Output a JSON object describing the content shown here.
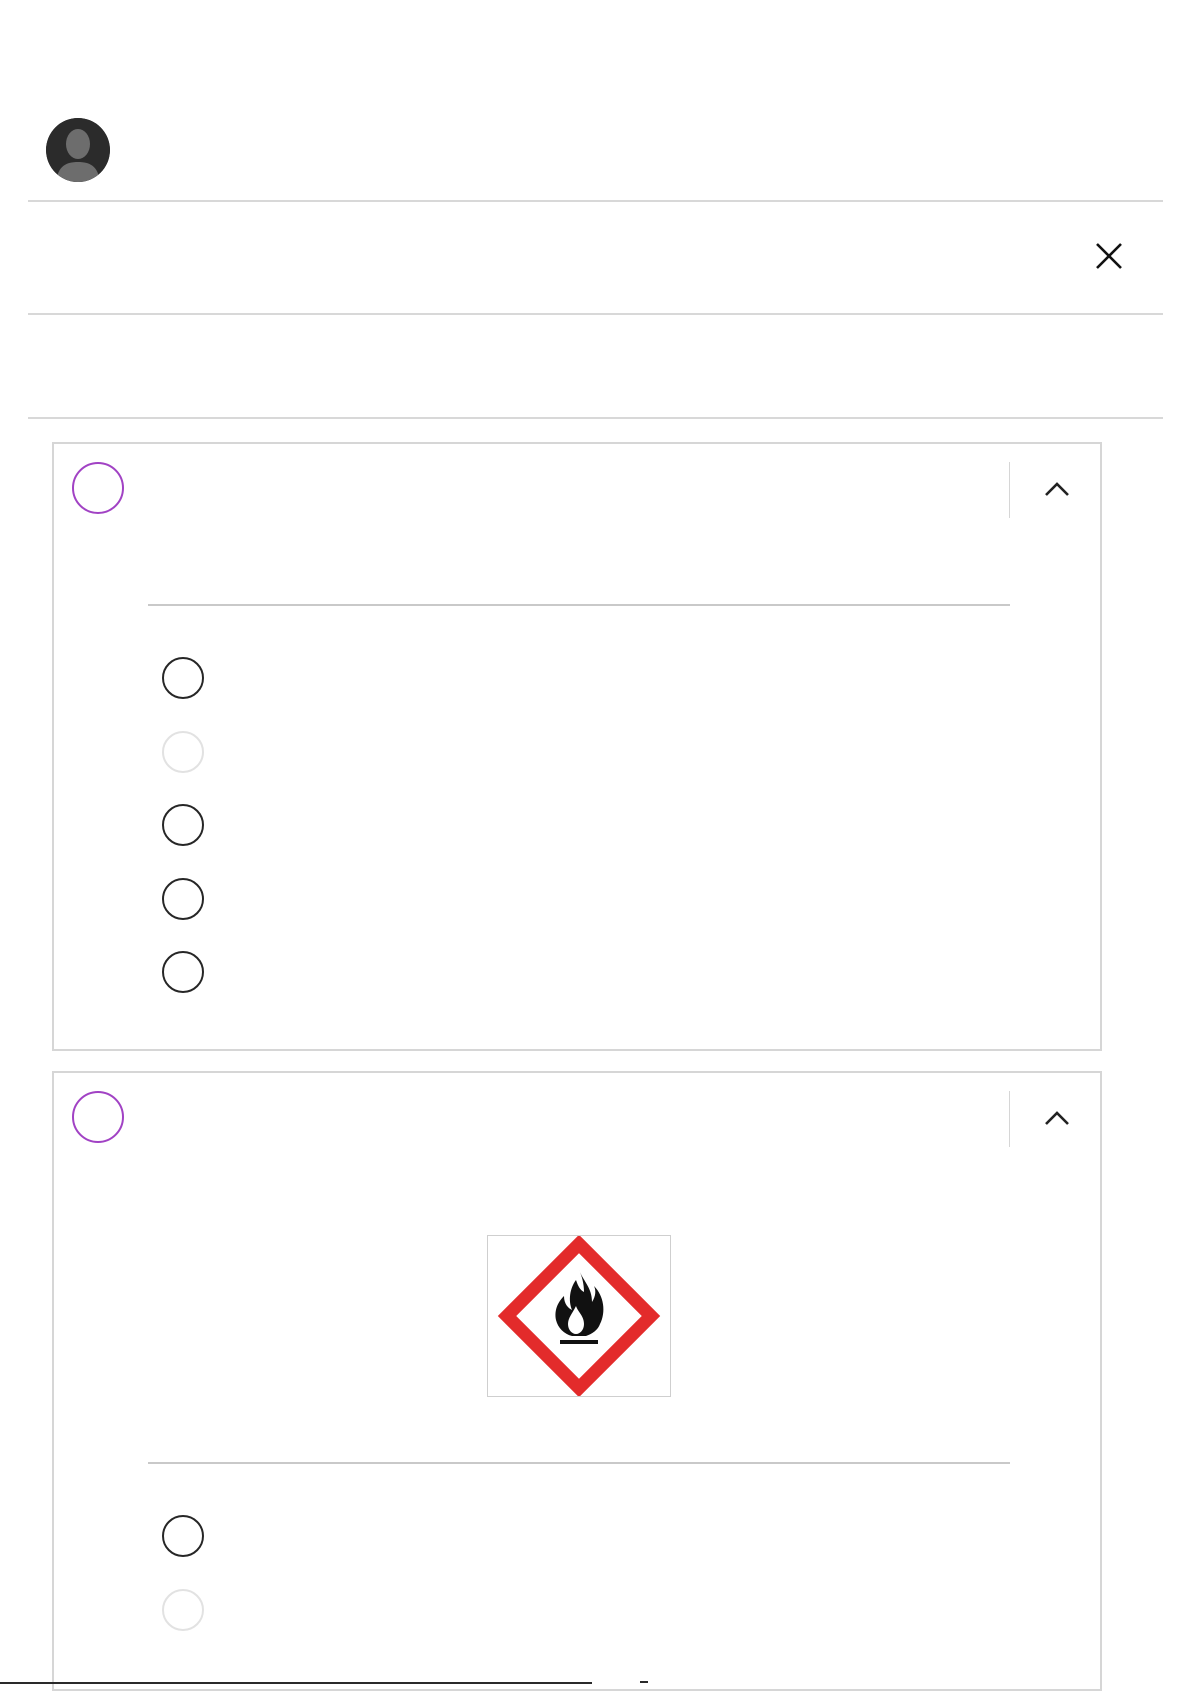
{
  "header": {
    "avatar_icon": "user-silhouette-icon",
    "close_icon": "close-icon"
  },
  "questions": [
    {
      "status_icon": "status-circle-icon",
      "status_color": "#a142c4",
      "collapse_icon": "chevron-up-icon",
      "has_image": false,
      "options": [
        {
          "label": "",
          "state": "normal"
        },
        {
          "label": "",
          "state": "faded"
        },
        {
          "label": "",
          "state": "normal"
        },
        {
          "label": "",
          "state": "normal"
        },
        {
          "label": "",
          "state": "normal"
        }
      ]
    },
    {
      "status_icon": "status-circle-icon",
      "status_color": "#a142c4",
      "collapse_icon": "chevron-up-icon",
      "has_image": true,
      "image_icon": "flammable-hazard-pictogram-icon",
      "hazard_color": "#e32b2b",
      "options": [
        {
          "label": "",
          "state": "normal"
        },
        {
          "label": "",
          "state": "faded"
        }
      ]
    }
  ]
}
